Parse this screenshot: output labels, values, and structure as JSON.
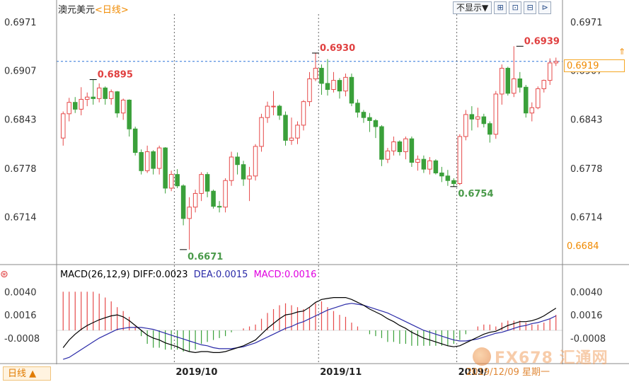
{
  "header": {
    "title": "澳元美元",
    "period": "<日线>",
    "toolbar": {
      "display_select": "不显示▼",
      "buttons": [
        "⊞",
        "⊡",
        "⊟",
        "⊳"
      ]
    }
  },
  "colors": {
    "up": "#e64a4a",
    "down": "#3aa03a",
    "current_line": "#2a74d8",
    "diff": "#000000",
    "dea": "#2a2aa8",
    "macd": "#e000e0",
    "accent": "#f08a00"
  },
  "chart_data": [
    {
      "type": "candlestick",
      "title": "澳元美元 日线",
      "y_ticks_left": [
        "0.6971",
        "0.6907",
        "0.6843",
        "0.6778",
        "0.6714"
      ],
      "y_ticks_right": [
        "0.6971",
        "0.6907",
        "0.6843",
        "0.6778",
        "0.6714"
      ],
      "ylim": [
        0.6655,
        0.6985
      ],
      "x_labels": [
        {
          "label": "2019/10",
          "index": 19
        },
        {
          "label": "2019/11",
          "index": 43
        },
        {
          "label": "2019/",
          "index": 66
        }
      ],
      "current_price": "0.6919",
      "current_price_value": 0.6919,
      "lower_label": "0.6684",
      "annotations": [
        {
          "text": "0.6895",
          "index": 5,
          "value": 0.6895,
          "kind": "high"
        },
        {
          "text": "0.6930",
          "index": 42,
          "value": 0.693,
          "kind": "high"
        },
        {
          "text": "0.6939",
          "index": 76,
          "value": 0.6939,
          "kind": "high"
        },
        {
          "text": "0.6671",
          "index": 20,
          "value": 0.6671,
          "kind": "low"
        },
        {
          "text": "0.6754",
          "index": 65,
          "value": 0.6754,
          "kind": "low"
        }
      ],
      "candles": [
        [
          0.6818,
          0.6853,
          0.6808,
          0.685
        ],
        [
          0.685,
          0.6871,
          0.684,
          0.6865
        ],
        [
          0.6865,
          0.6872,
          0.6851,
          0.6856
        ],
        [
          0.6856,
          0.6885,
          0.6848,
          0.6869
        ],
        [
          0.6869,
          0.6878,
          0.686,
          0.6872
        ],
        [
          0.6872,
          0.6895,
          0.6862,
          0.687
        ],
        [
          0.687,
          0.689,
          0.6865,
          0.6884
        ],
        [
          0.6884,
          0.6886,
          0.6862,
          0.687
        ],
        [
          0.687,
          0.6882,
          0.6862,
          0.6879
        ],
        [
          0.6879,
          0.688,
          0.6845,
          0.6851
        ],
        [
          0.6851,
          0.687,
          0.6842,
          0.6868
        ],
        [
          0.6868,
          0.6869,
          0.682,
          0.683
        ],
        [
          0.683,
          0.6833,
          0.6795,
          0.6799
        ],
        [
          0.6799,
          0.6803,
          0.677,
          0.6775
        ],
        [
          0.6775,
          0.6808,
          0.6772,
          0.68
        ],
        [
          0.68,
          0.6802,
          0.677,
          0.6778
        ],
        [
          0.6778,
          0.6808,
          0.677,
          0.6805
        ],
        [
          0.6805,
          0.6806,
          0.6745,
          0.6752
        ],
        [
          0.6752,
          0.6775,
          0.6748,
          0.677
        ],
        [
          0.677,
          0.6777,
          0.6752,
          0.6755
        ],
        [
          0.6755,
          0.6757,
          0.6703,
          0.6712
        ],
        [
          0.6712,
          0.674,
          0.6671,
          0.6727
        ],
        [
          0.6727,
          0.675,
          0.672,
          0.6745
        ],
        [
          0.6745,
          0.6773,
          0.6735,
          0.677
        ],
        [
          0.677,
          0.6773,
          0.674,
          0.6748
        ],
        [
          0.6748,
          0.675,
          0.6725,
          0.6728
        ],
        [
          0.6728,
          0.6735,
          0.672,
          0.6727
        ],
        [
          0.6727,
          0.6765,
          0.672,
          0.6762
        ],
        [
          0.6762,
          0.68,
          0.6755,
          0.6793
        ],
        [
          0.6793,
          0.6799,
          0.677,
          0.6783
        ],
        [
          0.6783,
          0.6788,
          0.6755,
          0.6764
        ],
        [
          0.6764,
          0.678,
          0.6735,
          0.6768
        ],
        [
          0.6768,
          0.681,
          0.6762,
          0.6807
        ],
        [
          0.6807,
          0.685,
          0.68,
          0.6845
        ],
        [
          0.6845,
          0.6866,
          0.6838,
          0.686
        ],
        [
          0.686,
          0.688,
          0.6848,
          0.686
        ],
        [
          0.686,
          0.6862,
          0.6842,
          0.6848
        ],
        [
          0.6848,
          0.6853,
          0.6808,
          0.6815
        ],
        [
          0.6815,
          0.6845,
          0.6809,
          0.6818
        ],
        [
          0.6818,
          0.684,
          0.681,
          0.6835
        ],
        [
          0.6835,
          0.6868,
          0.6828,
          0.6866
        ],
        [
          0.6866,
          0.6905,
          0.686,
          0.6896
        ],
        [
          0.6896,
          0.693,
          0.6893,
          0.691
        ],
        [
          0.691,
          0.6915,
          0.6875,
          0.689
        ],
        [
          0.689,
          0.6922,
          0.6874,
          0.6882
        ],
        [
          0.6882,
          0.6905,
          0.6878,
          0.6894
        ],
        [
          0.6894,
          0.6897,
          0.687,
          0.688
        ],
        [
          0.688,
          0.6903,
          0.6873,
          0.6898
        ],
        [
          0.6898,
          0.6903,
          0.686,
          0.6864
        ],
        [
          0.6864,
          0.6869,
          0.6845,
          0.6852
        ],
        [
          0.6852,
          0.6855,
          0.6838,
          0.6845
        ],
        [
          0.6845,
          0.6851,
          0.6826,
          0.6841
        ],
        [
          0.6841,
          0.6843,
          0.6818,
          0.6833
        ],
        [
          0.6833,
          0.6835,
          0.6781,
          0.679
        ],
        [
          0.679,
          0.6805,
          0.6785,
          0.6801
        ],
        [
          0.6801,
          0.682,
          0.6795,
          0.6813
        ],
        [
          0.6813,
          0.6815,
          0.6795,
          0.68
        ],
        [
          0.68,
          0.682,
          0.679,
          0.6817
        ],
        [
          0.6817,
          0.682,
          0.678,
          0.6786
        ],
        [
          0.6786,
          0.6795,
          0.6775,
          0.679
        ],
        [
          0.679,
          0.6795,
          0.6772,
          0.6777
        ],
        [
          0.6777,
          0.6793,
          0.677,
          0.6788
        ],
        [
          0.6788,
          0.679,
          0.677,
          0.6772
        ],
        [
          0.6772,
          0.678,
          0.676,
          0.6768
        ],
        [
          0.6768,
          0.6776,
          0.6755,
          0.6762
        ],
        [
          0.6762,
          0.6765,
          0.6754,
          0.6758
        ],
        [
          0.6758,
          0.6823,
          0.6756,
          0.682
        ],
        [
          0.682,
          0.6855,
          0.6815,
          0.6849
        ],
        [
          0.6849,
          0.686,
          0.6828,
          0.6843
        ],
        [
          0.6843,
          0.6858,
          0.6832,
          0.6846
        ],
        [
          0.6846,
          0.685,
          0.6832,
          0.6837
        ],
        [
          0.6837,
          0.684,
          0.6812,
          0.6823
        ],
        [
          0.6823,
          0.688,
          0.6817,
          0.6876
        ],
        [
          0.6876,
          0.6915,
          0.6862,
          0.691
        ],
        [
          0.691,
          0.6912,
          0.6874,
          0.6877
        ],
        [
          0.6877,
          0.6939,
          0.6872,
          0.6896
        ],
        [
          0.6896,
          0.6905,
          0.6878,
          0.6885
        ],
        [
          0.6885,
          0.6888,
          0.6845,
          0.6851
        ],
        [
          0.6851,
          0.6865,
          0.684,
          0.6858
        ],
        [
          0.6858,
          0.6886,
          0.6856,
          0.6883
        ],
        [
          0.6883,
          0.6895,
          0.6878,
          0.6894
        ],
        [
          0.6894,
          0.6923,
          0.6888,
          0.6917
        ],
        [
          0.6917,
          0.6924,
          0.6913,
          0.6919
        ]
      ]
    },
    {
      "type": "macd",
      "legend": {
        "name": "MACD(26,12,9)",
        "diff": "DIFF:0.0023",
        "dea": "DEA:0.0015",
        "macd": "MACD:0.0016"
      },
      "y_ticks_left": [
        "0.0040",
        "0.0016",
        "-0.0008"
      ],
      "y_ticks_right": [
        "0.0040",
        "0.0016",
        "-0.0008"
      ],
      "ylim": [
        -0.0033,
        0.0052
      ],
      "diff": [
        -0.0018,
        -0.001,
        -0.0004,
        0.0001,
        0.0005,
        0.0008,
        0.0011,
        0.0013,
        0.0015,
        0.0016,
        0.0014,
        0.001,
        0.0005,
        0.0,
        -0.0005,
        -0.0008,
        -0.001,
        -0.0013,
        -0.0015,
        -0.0017,
        -0.002,
        -0.0022,
        -0.0023,
        -0.0022,
        -0.0022,
        -0.0023,
        -0.0023,
        -0.0022,
        -0.002,
        -0.0018,
        -0.0016,
        -0.0013,
        -0.001,
        -0.0004,
        0.0002,
        0.0007,
        0.0012,
        0.0016,
        0.0017,
        0.0019,
        0.002,
        0.0024,
        0.0029,
        0.0032,
        0.0033,
        0.0034,
        0.0034,
        0.0034,
        0.0032,
        0.0029,
        0.0026,
        0.0022,
        0.0019,
        0.0016,
        0.0012,
        0.0009,
        0.0005,
        0.0002,
        -0.0002,
        -0.0005,
        -0.0008,
        -0.001,
        -0.0012,
        -0.0014,
        -0.0016,
        -0.0017,
        -0.0016,
        -0.0013,
        -0.001,
        -0.0007,
        -0.0004,
        -0.0002,
        -0.0001,
        0.0002,
        0.0005,
        0.0007,
        0.0009,
        0.0009,
        0.001,
        0.0012,
        0.0015,
        0.0019,
        0.0023
      ],
      "dea": [
        -0.003,
        -0.0028,
        -0.0024,
        -0.002,
        -0.0016,
        -0.0012,
        -0.0008,
        -0.0005,
        -0.0002,
        0.0001,
        0.0002,
        0.0003,
        0.0003,
        0.0003,
        0.0002,
        0.0001,
        -0.0001,
        -0.0003,
        -0.0005,
        -0.0007,
        -0.0009,
        -0.0011,
        -0.0013,
        -0.0015,
        -0.0016,
        -0.0018,
        -0.0019,
        -0.0019,
        -0.0019,
        -0.0018,
        -0.0017,
        -0.0015,
        -0.0013,
        -0.001,
        -0.0007,
        -0.0004,
        -0.0001,
        0.0002,
        0.0004,
        0.0007,
        0.0009,
        0.0012,
        0.0015,
        0.0018,
        0.0021,
        0.0023,
        0.0025,
        0.0027,
        0.0028,
        0.0027,
        0.0026,
        0.0024,
        0.0022,
        0.002,
        0.0018,
        0.0015,
        0.0012,
        0.0009,
        0.0006,
        0.0003,
        0.0,
        -0.0002,
        -0.0004,
        -0.0006,
        -0.0008,
        -0.001,
        -0.0011,
        -0.0011,
        -0.001,
        -0.0009,
        -0.0007,
        -0.0005,
        -0.0003,
        -0.0002,
        0.0,
        0.0002,
        0.0004,
        0.0005,
        0.0007,
        0.0008,
        0.001,
        0.0012,
        0.0015
      ],
      "macd": [
        0.004,
        0.004,
        0.004,
        0.004,
        0.004,
        0.004,
        0.0038,
        0.0034,
        0.003,
        0.0024,
        0.002,
        0.0014,
        0.0004,
        -0.0006,
        -0.0014,
        -0.0018,
        -0.0018,
        -0.002,
        -0.002,
        -0.002,
        -0.0022,
        -0.0022,
        -0.002,
        -0.0014,
        -0.0012,
        -0.001,
        -0.0008,
        -0.0006,
        -0.0002,
        0.0,
        0.0002,
        0.0004,
        0.0006,
        0.0012,
        0.0018,
        0.0022,
        0.0026,
        0.0028,
        0.0026,
        0.0024,
        0.0022,
        0.0024,
        0.0028,
        0.003,
        0.0024,
        0.002,
        0.0016,
        0.0014,
        0.0008,
        0.0004,
        0.0,
        -0.0004,
        -0.0006,
        -0.0008,
        -0.0012,
        -0.0012,
        -0.0014,
        -0.0014,
        -0.0016,
        -0.0016,
        -0.0016,
        -0.0016,
        -0.0016,
        -0.0016,
        -0.0016,
        -0.0014,
        -0.001,
        -0.0004,
        0.0,
        0.0004,
        0.0006,
        0.0006,
        0.0004,
        0.0008,
        0.001,
        0.001,
        0.001,
        0.0008,
        0.0006,
        0.0006,
        0.0008,
        0.0012,
        0.0016
      ]
    }
  ],
  "footer": {
    "period_tab": "日线 ▲",
    "date": "2019/12/09 星期一",
    "watermark": "FX678 汇通网"
  }
}
